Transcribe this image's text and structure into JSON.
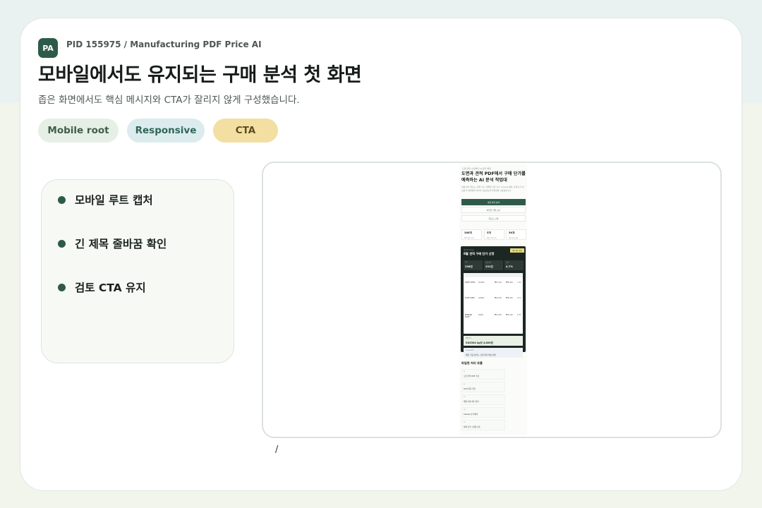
{
  "header": {
    "badge": "PA",
    "pid": "PID 155975 / Manufacturing PDF Price AI",
    "title": "모바일에서도 유지되는 구매 분석 첫 화면",
    "subtitle": "좁은 화면에서도 핵심 메시지와 CTA가 잘리지 않게 구성했습니다."
  },
  "chips": [
    "Mobile root",
    "Responsive",
    "CTA"
  ],
  "checklist": [
    "모바일 루트 캡처",
    "긴 제목 줄바꿈 확인",
    "검토 CTA 유지"
  ],
  "path": "/",
  "phone": {
    "eyebrow": "도면·견적 수집부터 AI 원가 예측",
    "title": "도면과 견적 PDF에서 구매 단가를 예측하는 AI 분석 작업대",
    "desc": "대량 PDF 업로드, 항목 추출, 재질별 기준 단가, Claude 예측, 실제 단가 비교를 한 화면에서 이어서 검토하도록 작업대를 구성했습니다.",
    "btn_primary": "샘플 파일 분석",
    "btn_secondary": "파일럿 작업 보기",
    "btn_tertiary": "업로드 단계",
    "stats": [
      {
        "value": "386개",
        "label": "PDF 원본 수집"
      },
      {
        "value": "5개",
        "label": "재질 기준 단가"
      },
      {
        "value": "56개",
        "label": "예측 비교 완료"
      }
    ],
    "dark": {
      "label": "추천 단가 비교",
      "title": "8월 견적 구매 단가 산정",
      "tag": "예측 검토 필요",
      "mini": [
        {
          "label": "PDF",
          "value": "238건"
        },
        {
          "label": "추출 항목",
          "value": "231건"
        },
        {
          "label": "오차",
          "value": "4.7%"
        }
      ],
      "rows": [
        {
          "name": "SHEET STEEL",
          "code": "SUS304",
          "vals": [
            "₩52,100",
            "₩58,400"
          ],
          "pct": "7.4%"
        },
        {
          "name": "PLATE STEEL",
          "code": "AL6061",
          "vals": [
            "₩44,700",
            "₩46,200"
          ],
          "pct": "3.1%"
        },
        {
          "name": "BENDING PLATE",
          "code": "SS400",
          "vals": [
            "₩31,300",
            "₩33,100"
          ],
          "pct": "5.4%"
        }
      ],
      "card1": {
        "label": "재질 단가",
        "value": "SUS304 kg당 4,800원"
      },
      "card2": {
        "label": "Claude 요약",
        "value": "재질, 가공 난이도, 표면 처리 비용 분해"
      }
    },
    "section": "파일럿 처리 흐름",
    "steps": [
      {
        "n": "01",
        "t": "도면·견적 PDF 수집"
      },
      {
        "n": "02",
        "t": "OCR 항목 추출"
      },
      {
        "n": "03",
        "t": "재질·수량·치수 정리"
      },
      {
        "n": "04",
        "t": "Claude 단가 예측"
      },
      {
        "n": "05",
        "t": "실제 단가 오차율 검토"
      }
    ]
  }
}
